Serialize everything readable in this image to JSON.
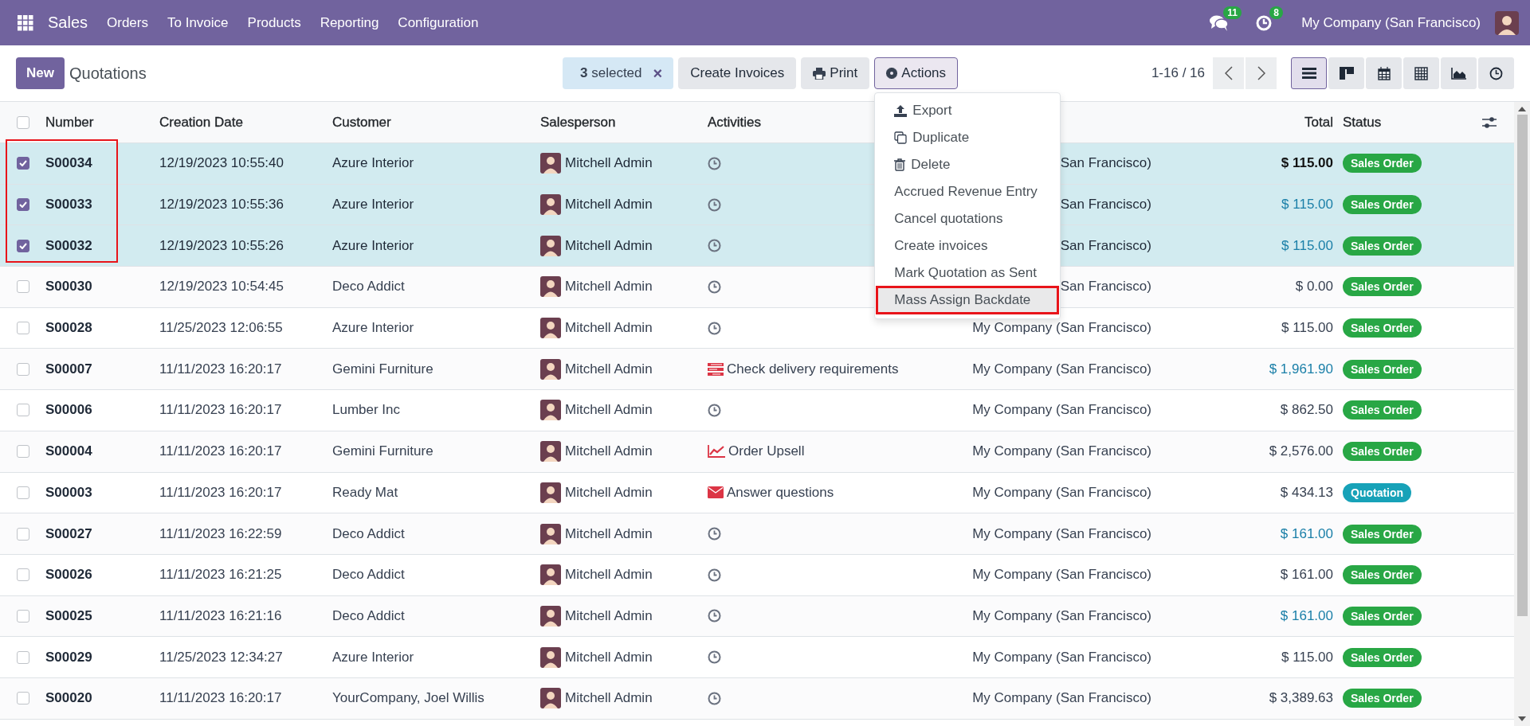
{
  "navbar": {
    "app": "Sales",
    "menu": [
      "Orders",
      "To Invoice",
      "Products",
      "Reporting",
      "Configuration"
    ],
    "messages_count": "11",
    "activities_count": "8",
    "company": "My Company (San Francisco)"
  },
  "control_panel": {
    "new_button": "New",
    "breadcrumb": "Quotations",
    "selection": "**3** selected",
    "clear_selection": "×",
    "buttons": [
      "Create Invoices",
      "Print"
    ],
    "actions": {
      "label": "Actions",
      "expanded": true
    },
    "pager": "1-16 / 16",
    "views": [
      {
        "selected": true
      },
      {
        "selected": false
      },
      {
        "selected": false
      },
      {
        "selected": false
      },
      {
        "selected": false
      },
      {
        "selected": false
      }
    ]
  },
  "actions_menu": [
    {
      "label": "Export",
      "selected": false
    },
    {
      "label": "Duplicate",
      "selected": false
    },
    {
      "label": "Delete",
      "selected": false
    },
    {
      "label": "Accrued Revenue Entry",
      "selected": false
    },
    {
      "label": "Cancel quotations",
      "selected": false
    },
    {
      "label": "Create invoices",
      "selected": false
    },
    {
      "label": "Mark Quotation as Sent",
      "selected": false
    },
    {
      "label": "Mass Assign Backdate",
      "selected": true
    }
  ],
  "table": {
    "select_all": {
      "checked": false
    },
    "columns": [
      "Number",
      "Creation Date",
      "Customer",
      "Salesperson",
      "Activities",
      "Total",
      "Status"
    ],
    "rows": [
      {
        "checked": true,
        "number": "S00034",
        "date": "12/19/2023 10:55:40",
        "customer": "Azure Interior",
        "salesperson": "Mitchell Admin",
        "activity": {
          "kind": "none"
        },
        "company": "San Francisco)",
        "total": "$ 115.00",
        "focused": true,
        "total_link": false,
        "status": {
          "label": "Sales Order",
          "color": "#28a745"
        }
      },
      {
        "checked": true,
        "number": "S00033",
        "date": "12/19/2023 10:55:36",
        "customer": "Azure Interior",
        "salesperson": "Mitchell Admin",
        "activity": {
          "kind": "none"
        },
        "company": "San Francisco)",
        "total": "$ 115.00",
        "focused": false,
        "total_link": true,
        "status": {
          "label": "Sales Order",
          "color": "#28a745"
        }
      },
      {
        "checked": true,
        "number": "S00032",
        "date": "12/19/2023 10:55:26",
        "customer": "Azure Interior",
        "salesperson": "Mitchell Admin",
        "activity": {
          "kind": "none"
        },
        "company": "San Francisco)",
        "total": "$ 115.00",
        "focused": false,
        "total_link": true,
        "status": {
          "label": "Sales Order",
          "color": "#28a745"
        }
      },
      {
        "checked": false,
        "number": "S00030",
        "date": "12/19/2023 10:54:45",
        "customer": "Deco Addict",
        "salesperson": "Mitchell Admin",
        "activity": {
          "kind": "none"
        },
        "company": "San Francisco)",
        "total": "$ 0.00",
        "focused": false,
        "total_link": false,
        "status": {
          "label": "Sales Order",
          "color": "#28a745"
        }
      },
      {
        "checked": false,
        "number": "S00028",
        "date": "11/25/2023 12:06:55",
        "customer": "Azure Interior",
        "salesperson": "Mitchell Admin",
        "activity": {
          "kind": "none"
        },
        "company": "My Company (San Francisco)",
        "total": "$ 115.00",
        "focused": false,
        "total_link": false,
        "status": {
          "label": "Sales Order",
          "color": "#28a745"
        }
      },
      {
        "checked": false,
        "number": "S00007",
        "date": "11/11/2023 16:20:17",
        "customer": "Gemini Furniture",
        "salesperson": "Mitchell Admin",
        "activity": {
          "kind": "todo",
          "text": "Check delivery requirements"
        },
        "company": "My Company (San Francisco)",
        "total": "$ 1,961.90",
        "focused": false,
        "total_link": true,
        "status": {
          "label": "Sales Order",
          "color": "#28a745"
        }
      },
      {
        "checked": false,
        "number": "S00006",
        "date": "11/11/2023 16:20:17",
        "customer": "Lumber Inc",
        "salesperson": "Mitchell Admin",
        "activity": {
          "kind": "none"
        },
        "company": "My Company (San Francisco)",
        "total": "$ 862.50",
        "focused": false,
        "total_link": false,
        "status": {
          "label": "Sales Order",
          "color": "#28a745"
        }
      },
      {
        "checked": false,
        "number": "S00004",
        "date": "11/11/2023 16:20:17",
        "customer": "Gemini Furniture",
        "salesperson": "Mitchell Admin",
        "activity": {
          "kind": "upsell",
          "text": "Order Upsell"
        },
        "company": "My Company (San Francisco)",
        "total": "$ 2,576.00",
        "focused": false,
        "total_link": false,
        "status": {
          "label": "Sales Order",
          "color": "#28a745"
        }
      },
      {
        "checked": false,
        "number": "S00003",
        "date": "11/11/2023 16:20:17",
        "customer": "Ready Mat",
        "salesperson": "Mitchell Admin",
        "activity": {
          "kind": "email",
          "text": "Answer questions"
        },
        "company": "My Company (San Francisco)",
        "total": "$ 434.13",
        "focused": false,
        "total_link": false,
        "status": {
          "label": "Quotation",
          "color": "#17a2b8"
        }
      },
      {
        "checked": false,
        "number": "S00027",
        "date": "11/11/2023 16:22:59",
        "customer": "Deco Addict",
        "salesperson": "Mitchell Admin",
        "activity": {
          "kind": "none"
        },
        "company": "My Company (San Francisco)",
        "total": "$ 161.00",
        "focused": false,
        "total_link": true,
        "status": {
          "label": "Sales Order",
          "color": "#28a745"
        }
      },
      {
        "checked": false,
        "number": "S00026",
        "date": "11/11/2023 16:21:25",
        "customer": "Deco Addict",
        "salesperson": "Mitchell Admin",
        "activity": {
          "kind": "none"
        },
        "company": "My Company (San Francisco)",
        "total": "$ 161.00",
        "focused": false,
        "total_link": false,
        "status": {
          "label": "Sales Order",
          "color": "#28a745"
        }
      },
      {
        "checked": false,
        "number": "S00025",
        "date": "11/11/2023 16:21:16",
        "customer": "Deco Addict",
        "salesperson": "Mitchell Admin",
        "activity": {
          "kind": "none"
        },
        "company": "My Company (San Francisco)",
        "total": "$ 161.00",
        "focused": false,
        "total_link": true,
        "status": {
          "label": "Sales Order",
          "color": "#28a745"
        }
      },
      {
        "checked": false,
        "number": "S00029",
        "date": "11/25/2023 12:34:27",
        "customer": "Azure Interior",
        "salesperson": "Mitchell Admin",
        "activity": {
          "kind": "none"
        },
        "company": "My Company (San Francisco)",
        "total": "$ 115.00",
        "focused": false,
        "total_link": false,
        "status": {
          "label": "Sales Order",
          "color": "#28a745"
        }
      },
      {
        "checked": false,
        "number": "S00020",
        "date": "11/11/2023 16:20:17",
        "customer": "YourCompany, Joel Willis",
        "salesperson": "Mitchell Admin",
        "activity": {
          "kind": "none"
        },
        "company": "My Company (San Francisco)",
        "total": "$ 3,389.63",
        "focused": false,
        "total_link": false,
        "status": {
          "label": "Sales Order",
          "color": "#28a745"
        }
      }
    ]
  }
}
